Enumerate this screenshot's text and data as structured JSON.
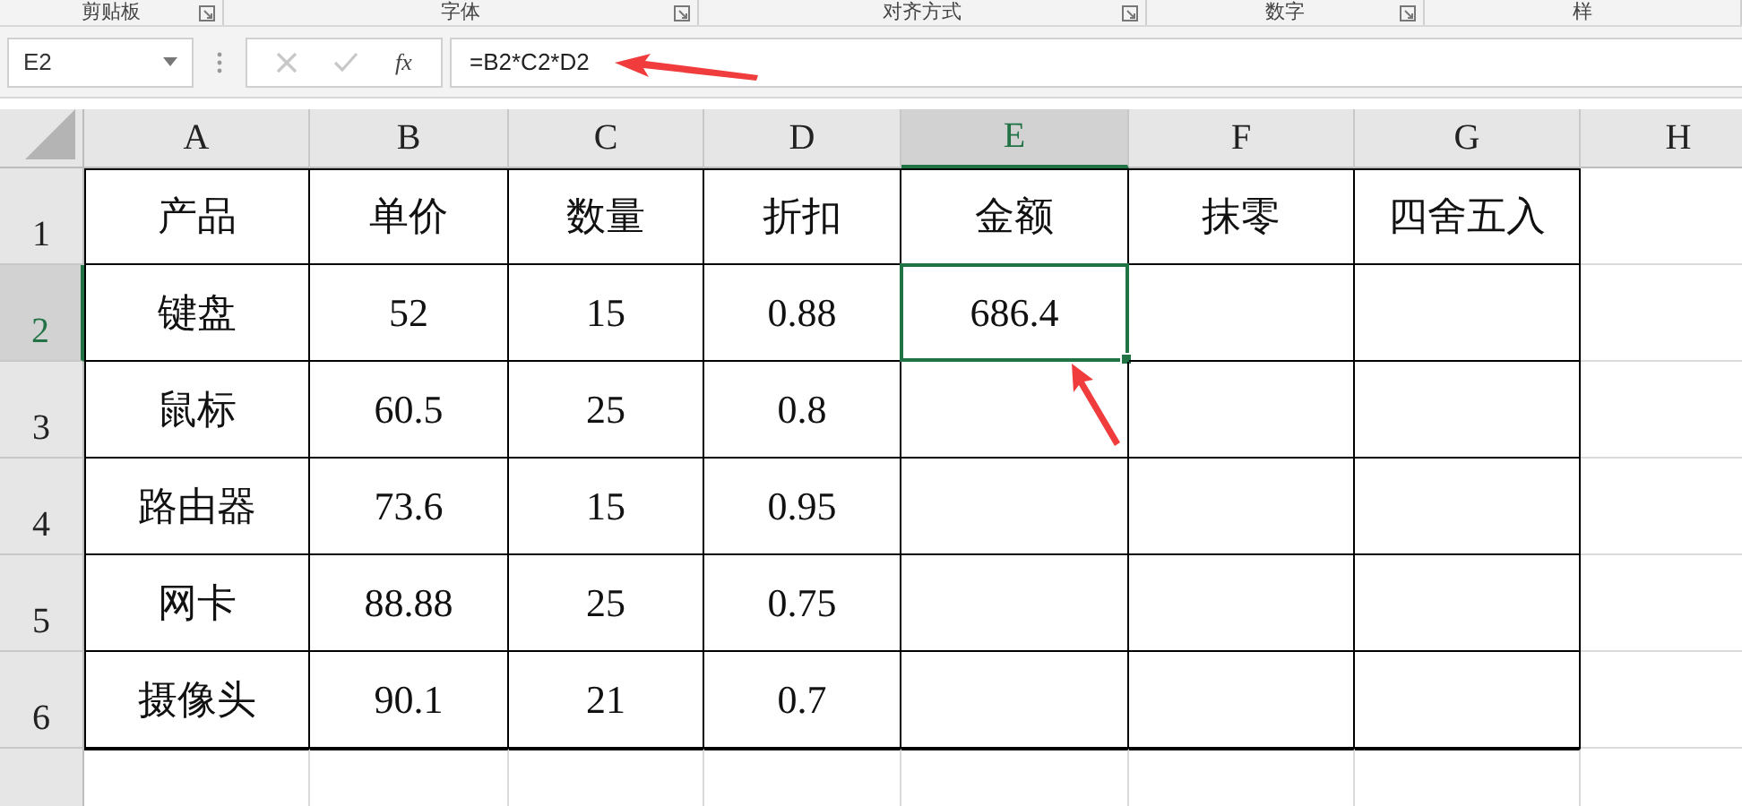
{
  "ribbon_groups": [
    {
      "label": "剪贴板"
    },
    {
      "label": "字体"
    },
    {
      "label": "对齐方式"
    },
    {
      "label": "数字"
    },
    {
      "label": "样"
    }
  ],
  "name_box": {
    "value": "E2"
  },
  "fx_label": "fx",
  "formula_bar": {
    "value": "=B2*C2*D2"
  },
  "columns": [
    {
      "label": "A",
      "selected": false
    },
    {
      "label": "B",
      "selected": false
    },
    {
      "label": "C",
      "selected": false
    },
    {
      "label": "D",
      "selected": false
    },
    {
      "label": "E",
      "selected": true
    },
    {
      "label": "F",
      "selected": false
    },
    {
      "label": "G",
      "selected": false
    },
    {
      "label": "H",
      "selected": false
    }
  ],
  "rows": [
    {
      "label": "1",
      "selected": false,
      "cells": [
        "产品",
        "单价",
        "数量",
        "折扣",
        "金额",
        "抹零",
        "四舍五入"
      ]
    },
    {
      "label": "2",
      "selected": true,
      "cells": [
        "键盘",
        "52",
        "15",
        "0.88",
        "686.4"
      ]
    },
    {
      "label": "3",
      "selected": false,
      "cells": [
        "鼠标",
        "60.5",
        "25",
        "0.8"
      ]
    },
    {
      "label": "4",
      "selected": false,
      "cells": [
        "路由器",
        "73.6",
        "15",
        "0.95"
      ]
    },
    {
      "label": "5",
      "selected": false,
      "cells": [
        "网卡",
        "88.88",
        "25",
        "0.75"
      ]
    },
    {
      "label": "6",
      "selected": false,
      "cells": [
        "摄像头",
        "90.1",
        "21",
        "0.7"
      ]
    }
  ]
}
